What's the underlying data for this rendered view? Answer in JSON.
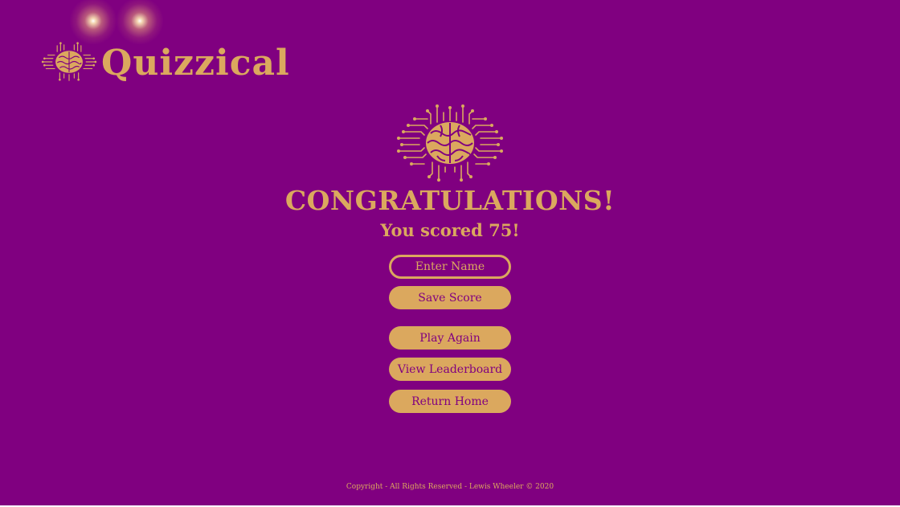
{
  "header": {
    "logo_text": "Quizzical"
  },
  "result": {
    "heading": "CONGRATULATIONS!",
    "score_text": "You scored 75!"
  },
  "form": {
    "name_placeholder": "Enter Name",
    "save_label": "Save Score"
  },
  "actions": {
    "play_again": "Play Again",
    "leaderboard": "View Leaderboard",
    "home": "Return Home"
  },
  "footer": {
    "copyright": "Copyright - All Rights Reserved - Lewis Wheeler © 2020"
  },
  "theme": {
    "background": "#800080",
    "accent": "#dba85e"
  }
}
